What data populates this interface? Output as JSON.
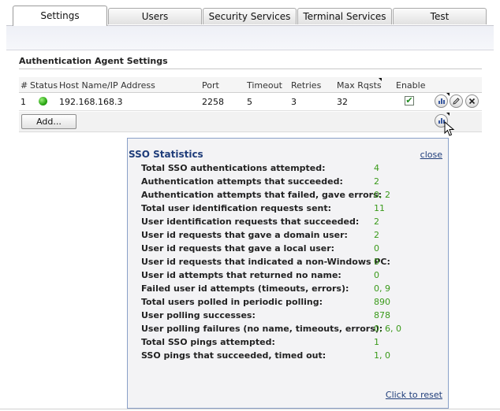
{
  "tabs": [
    {
      "label": "Settings",
      "active": true
    },
    {
      "label": "Users",
      "active": false
    },
    {
      "label": "Security Services",
      "active": false
    },
    {
      "label": "Terminal Services",
      "active": false
    },
    {
      "label": "Test",
      "active": false
    }
  ],
  "section": {
    "title": "Authentication Agent Settings"
  },
  "table": {
    "headers": {
      "num": "#",
      "status": "Status",
      "host": "Host Name/IP Address",
      "port": "Port",
      "timeout": "Timeout",
      "retries": "Retries",
      "max_rqsts": "Max Rqsts",
      "enable": "Enable"
    },
    "rows": [
      {
        "num": "1",
        "status": "online",
        "host": "192.168.168.3",
        "port": "2258",
        "timeout": "5",
        "retries": "3",
        "max_rqsts": "32",
        "enabled": true,
        "enabled_mark": "✔"
      }
    ],
    "add_label": "Add..."
  },
  "icons": {
    "statistics": "bar-chart-icon",
    "edit": "pencil-icon",
    "delete": "x-delete-icon",
    "status": "green-status-dot-icon"
  },
  "popup": {
    "title": "SSO Statistics",
    "close_label": "close",
    "reset_label": "Click to reset",
    "stats": [
      {
        "label": "Total SSO authentications attempted:",
        "value": "4"
      },
      {
        "label": "Authentication attempts that succeeded:",
        "value": "2"
      },
      {
        "label": "Authentication attempts that failed, gave errors:",
        "value": "0, 2"
      },
      {
        "label": "Total user identification requests sent:",
        "value": "11"
      },
      {
        "label": "User identification requests that succeeded:",
        "value": "2"
      },
      {
        "label": "User id requests that gave a domain user:",
        "value": "2"
      },
      {
        "label": "User id requests that gave a local user:",
        "value": "0"
      },
      {
        "label": "User id requests that indicated a non-Windows PC:",
        "value": "0"
      },
      {
        "label": "User id attempts that returned no name:",
        "value": "0"
      },
      {
        "label": "Failed user id attempts (timeouts, errors):",
        "value": "0, 9"
      },
      {
        "label": "Total users polled in periodic polling:",
        "value": "890"
      },
      {
        "label": "User polling successes:",
        "value": "878"
      },
      {
        "label": "User polling failures (no name, timeouts, errors):",
        "value": "0, 6, 0"
      },
      {
        "label": "Total SSO pings attempted:",
        "value": "1"
      },
      {
        "label": "SSO pings that succeeded, timed out:",
        "value": "1, 0"
      }
    ]
  },
  "colors": {
    "link": "#1f3d7a",
    "stat_value": "#3a9a1a",
    "status_online": "#2aa614"
  }
}
